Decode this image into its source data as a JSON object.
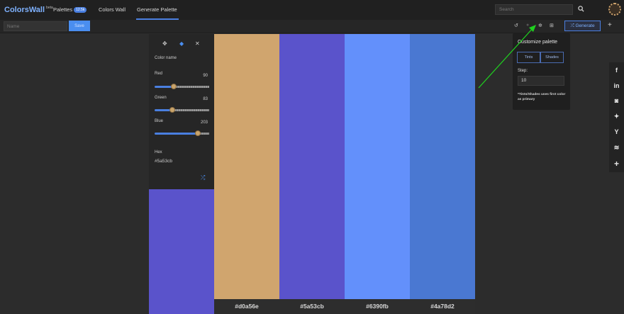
{
  "nav": {
    "brand": "ColorsWall",
    "brand_sup": "beta",
    "palettes": "Palettes",
    "palettes_badge": "12.5k",
    "colors_wall": "Colors Wall",
    "generate_palette": "Generate Palette",
    "search_placeholder": "Search",
    "search_icon": "search-icon"
  },
  "toolbar": {
    "name_placeholder": "Name",
    "save_label": "Save",
    "generate_label": "Generate",
    "icons": [
      "undo-icon",
      "redo-icon",
      "gear-icon",
      "grid-icon",
      "plus-icon"
    ]
  },
  "picker": {
    "modes": [
      "move-icon",
      "pin-icon",
      "shuffle-icon"
    ],
    "color_name": "Color name",
    "red_label": "Red",
    "red_value": "90",
    "green_label": "Green",
    "green_value": "83",
    "blue_label": "Blue",
    "blue_value": "203",
    "red_fraction": 0.353,
    "green_fraction": 0.325,
    "blue_fraction": 0.796,
    "hex_label": "Hex",
    "hex_value": "#5a53cb",
    "preview_color": "#5a53cb"
  },
  "palette": [
    {
      "color": "#d0a56e",
      "label": "#d0a56e"
    },
    {
      "color": "#5a53cb",
      "label": "#5a53cb"
    },
    {
      "color": "#6390fb",
      "label": "#6390fb"
    },
    {
      "color": "#4a78d2",
      "label": "#4a78d2"
    }
  ],
  "customize": {
    "title": "Customize palette",
    "tints_label": "Tints",
    "shades_label": "Shades",
    "step_label": "Step:",
    "step_value": "10",
    "note": "*Tints/Shades uses first color as primary"
  },
  "share": [
    "facebook-icon",
    "linkedin-icon",
    "pocket-icon",
    "twitter-icon",
    "hackernews-icon",
    "buffer-icon",
    "add-share-icon"
  ],
  "colors": {
    "accent": "#4a7fe0",
    "arrow": "#1fd01f"
  }
}
